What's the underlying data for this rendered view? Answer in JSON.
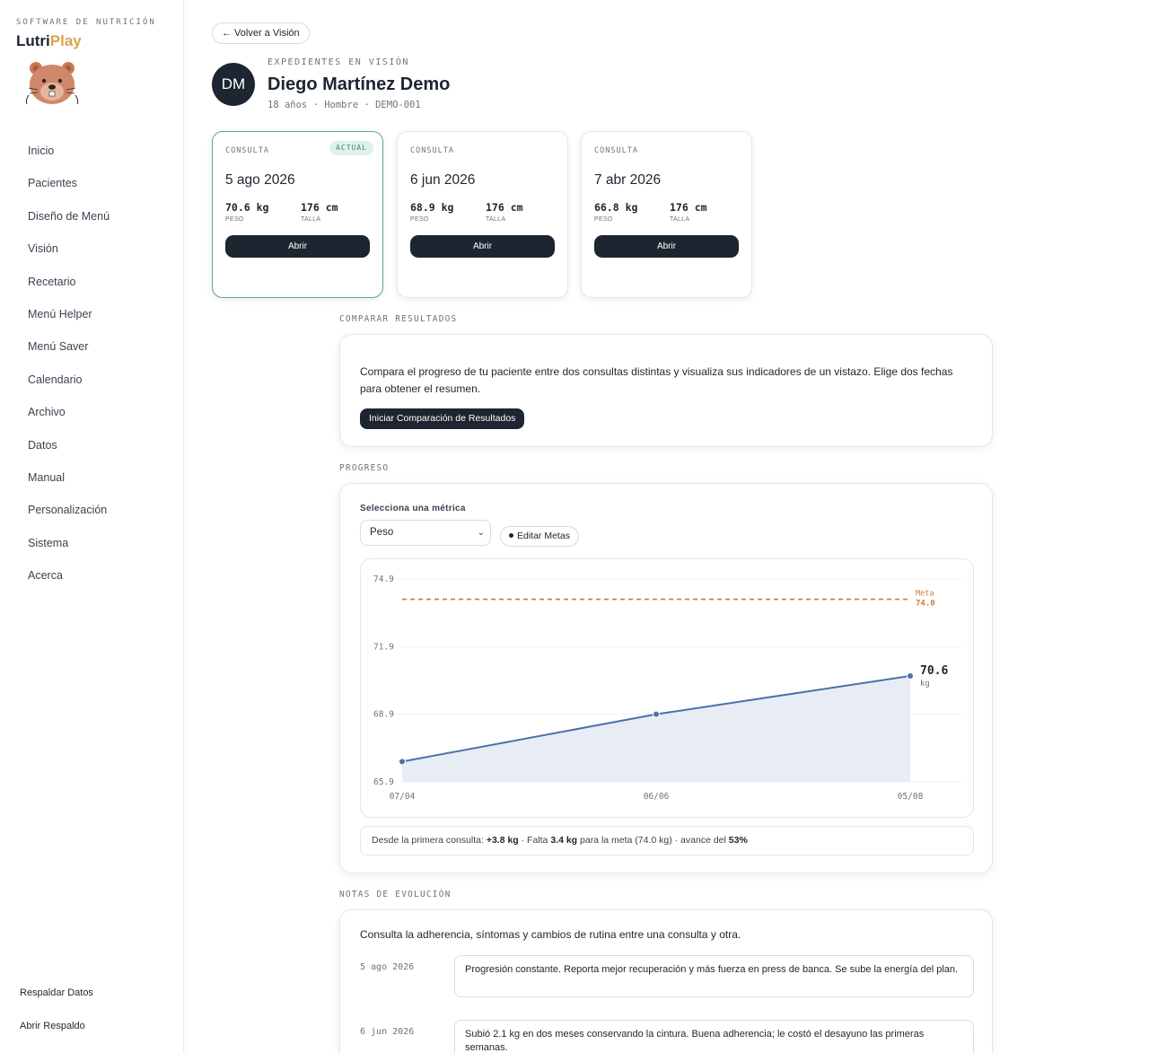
{
  "sidebar": {
    "brand_tag": "SOFTWARE DE NUTRICIÓN",
    "brand_name_a": "Lutri",
    "brand_name_b": "Play",
    "nav": [
      "Inicio",
      "Pacientes",
      "Diseño de Menú",
      "Visión",
      "Recetario",
      "Menú Helper",
      "Menú Saver",
      "Calendario",
      "Archivo",
      "Datos",
      "Manual",
      "Personalización",
      "Sistema",
      "Acerca"
    ],
    "footer": [
      "Respaldar Datos",
      "Abrir Respaldo"
    ]
  },
  "header": {
    "back_label": "← Volver a Visión",
    "eyebrow": "EXPEDIENTES EN VISIÓN",
    "initials": "DM",
    "name": "Diego Martínez Demo",
    "meta": "18 años · Hombre · DEMO-001"
  },
  "visits": [
    {
      "eyebrow": "CONSULTA",
      "badge": "ACTUAL",
      "date": "5 ago 2026",
      "weight": "70.6 kg",
      "weight_label": "PESO",
      "height": "176 cm",
      "height_label": "TALLA",
      "open_label": "Abrir"
    },
    {
      "eyebrow": "CONSULTA",
      "date": "6 jun 2026",
      "weight": "68.9 kg",
      "weight_label": "PESO",
      "height": "176 cm",
      "height_label": "TALLA",
      "open_label": "Abrir"
    },
    {
      "eyebrow": "CONSULTA",
      "date": "7 abr 2026",
      "weight": "66.8 kg",
      "weight_label": "PESO",
      "height": "176 cm",
      "height_label": "TALLA",
      "open_label": "Abrir"
    }
  ],
  "compare": {
    "section_label": "COMPARAR RESULTADOS",
    "text": "Compara el progreso de tu paciente entre dos consultas distintas y visualiza sus indicadores de un vistazo. Elige dos fechas para obtener el resumen.",
    "button_label": "Iniciar Comparación de Resultados"
  },
  "progress": {
    "section_label": "PROGRESO",
    "metric_label": "Selecciona una métrica",
    "metric_selected": "Peso",
    "goals_label": "Editar Metas",
    "summary": {
      "prefix": "Desde la primera consulta: ",
      "delta": "+3.8 kg",
      "mid": " · Falta ",
      "remaining": "3.4 kg",
      "mid2": " para la meta (74.0 kg) · avance del ",
      "percent": "53%"
    }
  },
  "chart_data": {
    "type": "area",
    "x": [
      "07/04",
      "06/06",
      "05/08"
    ],
    "series": [
      {
        "values": [
          66.8,
          68.9,
          70.6
        ]
      }
    ],
    "ylim": [
      65.9,
      74.9
    ],
    "yticks": [
      "74.9",
      "71.9",
      "68.9",
      "65.9"
    ],
    "ytick_values": [
      74.9,
      71.9,
      68.9,
      65.9
    ],
    "goal": {
      "label": "Meta",
      "value": 74.0,
      "value_text": "74.0"
    },
    "last_label": {
      "value": "70.6",
      "unit": "kg"
    },
    "grid": true,
    "colors": {
      "line": "#4a72ad",
      "fill": "#e8edf5",
      "goal": "#d07a3a"
    }
  },
  "notes": {
    "section_label": "NOTAS DE EVOLUCIÓN",
    "intro": "Consulta la adherencia, síntomas y cambios de rutina entre una consulta y otra.",
    "items": [
      {
        "date": "5 ago 2026",
        "text": "Progresión constante. Reporta mejor recuperación y más fuerza en press de banca. Se sube la energía del plan."
      },
      {
        "date": "6 jun 2026",
        "text": "Subió 2.1 kg en dos meses conservando la cintura. Buena adherencia; le costó el desayuno las primeras semanas."
      }
    ]
  }
}
